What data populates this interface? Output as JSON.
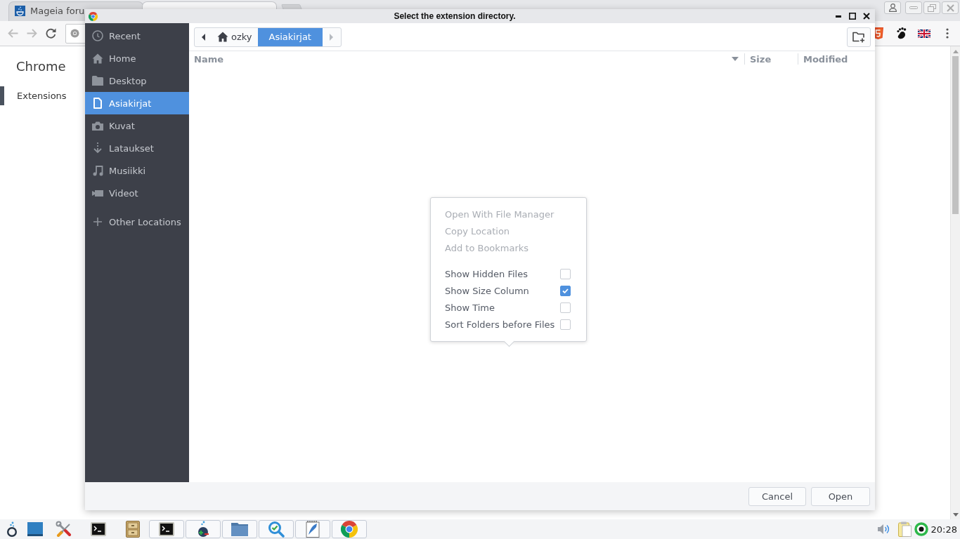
{
  "browser": {
    "tabs": [
      {
        "title": "Mageia foru",
        "selected": false
      },
      {
        "selected": true
      }
    ],
    "sidebar": {
      "title": "Chrome",
      "items": [
        {
          "label": "Extensions",
          "selected": true
        }
      ]
    }
  },
  "dialog": {
    "title": "Select the extension directory.",
    "places": [
      {
        "kind": "recent",
        "label": "Recent",
        "selected": false
      },
      {
        "kind": "home",
        "label": "Home",
        "selected": false
      },
      {
        "kind": "folder",
        "label": "Desktop",
        "selected": false
      },
      {
        "kind": "document",
        "label": "Asiakirjat",
        "selected": true
      },
      {
        "kind": "camera",
        "label": "Kuvat",
        "selected": false
      },
      {
        "kind": "download",
        "label": "Lataukset",
        "selected": false
      },
      {
        "kind": "music",
        "label": "Musiikki",
        "selected": false
      },
      {
        "kind": "video",
        "label": "Videot",
        "selected": false
      }
    ],
    "other_locations": "Other Locations",
    "path": [
      {
        "kind": "home",
        "label": "ozky",
        "selected": false
      },
      {
        "kind": "folder",
        "label": "Asiakirjat",
        "selected": true
      }
    ],
    "columns": [
      {
        "label": "Name",
        "sorted": true
      },
      {
        "label": "Size",
        "sorted": false
      },
      {
        "label": "Modified",
        "sorted": false
      }
    ],
    "menu": {
      "sections": [
        {
          "items": [
            {
              "kind": "action",
              "label": "Open With File Manager",
              "disabled": true
            },
            {
              "kind": "action",
              "label": "Copy Location",
              "disabled": true
            },
            {
              "kind": "action",
              "label": "Add to Bookmarks",
              "disabled": true
            }
          ]
        },
        {
          "items": [
            {
              "kind": "toggle",
              "label": "Show Hidden Files",
              "checked": false
            },
            {
              "kind": "toggle",
              "label": "Show Size Column",
              "checked": true
            },
            {
              "kind": "toggle",
              "label": "Show Time",
              "checked": false
            },
            {
              "kind": "toggle",
              "label": "Sort Folders before Files",
              "checked": false
            }
          ]
        }
      ]
    },
    "buttons": [
      "Cancel",
      "Open"
    ]
  },
  "taskbar": {
    "clock": "20:28"
  }
}
